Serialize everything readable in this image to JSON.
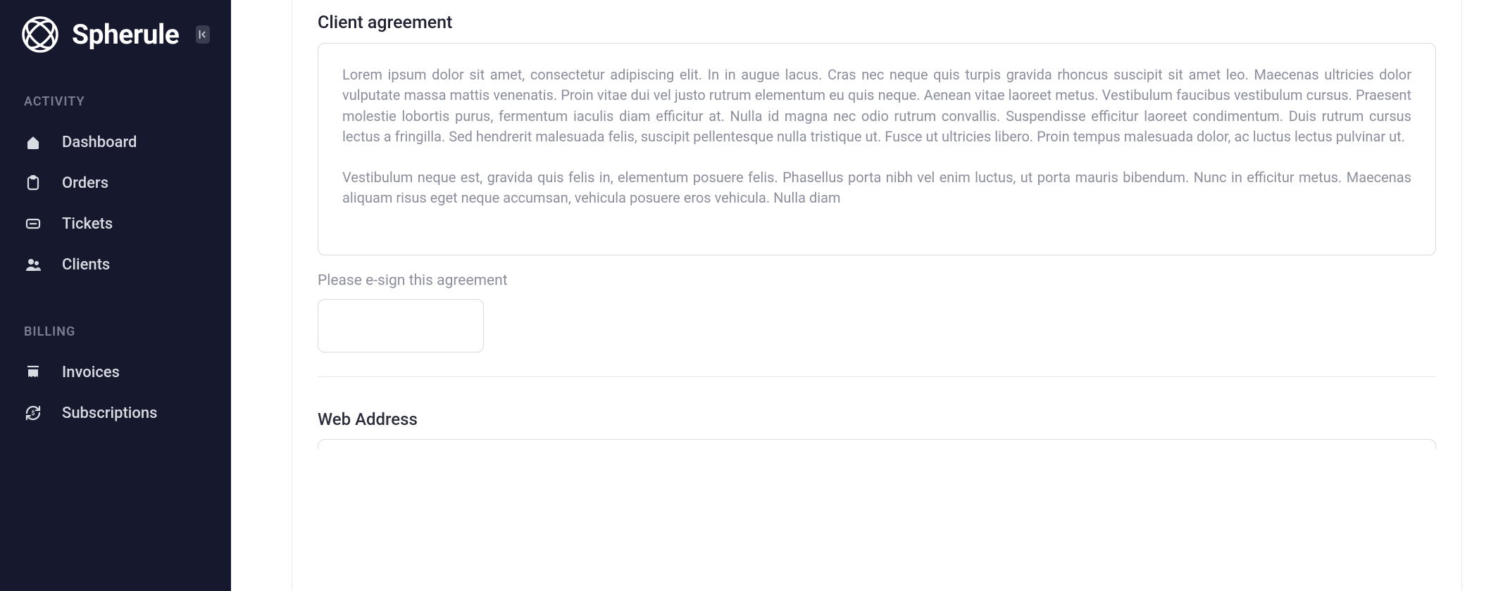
{
  "brand": {
    "name": "Spherule"
  },
  "sidebar": {
    "sections": [
      {
        "label": "ACTIVITY",
        "items": [
          {
            "label": "Dashboard"
          },
          {
            "label": "Orders"
          },
          {
            "label": "Tickets"
          },
          {
            "label": "Clients"
          }
        ]
      },
      {
        "label": "BILLING",
        "items": [
          {
            "label": "Invoices"
          },
          {
            "label": "Subscriptions"
          }
        ]
      }
    ]
  },
  "main": {
    "agreement": {
      "title": "Client agreement",
      "body_p1": "Lorem ipsum dolor sit amet, consectetur adipiscing elit. In in augue lacus. Cras nec neque quis turpis gravida rhoncus suscipit sit amet leo. Maecenas ultricies dolor vulputate massa mattis venenatis. Proin vitae dui vel justo rutrum elementum eu quis neque. Aenean vitae laoreet metus. Vestibulum faucibus vestibulum cursus. Praesent molestie lobortis purus, fermentum iaculis diam efficitur at. Nulla id magna nec odio rutrum convallis. Suspendisse efficitur laoreet condimentum. Duis rutrum cursus lectus a fringilla. Sed hendrerit malesuada felis, suscipit pellentesque nulla tristique ut. Fusce ut ultricies libero. Proin tempus malesuada dolor, ac luctus lectus pulvinar ut.",
      "body_p2": "Vestibulum neque est, gravida quis felis in, elementum posuere felis. Phasellus porta nibh vel enim luctus, ut porta mauris bibendum. Nunc in efficitur metus. Maecenas aliquam risus eget neque accumsan, vehicula posuere eros vehicula. Nulla diam",
      "helper": "Please e-sign this agreement"
    },
    "web_address": {
      "title": "Web Address"
    }
  }
}
